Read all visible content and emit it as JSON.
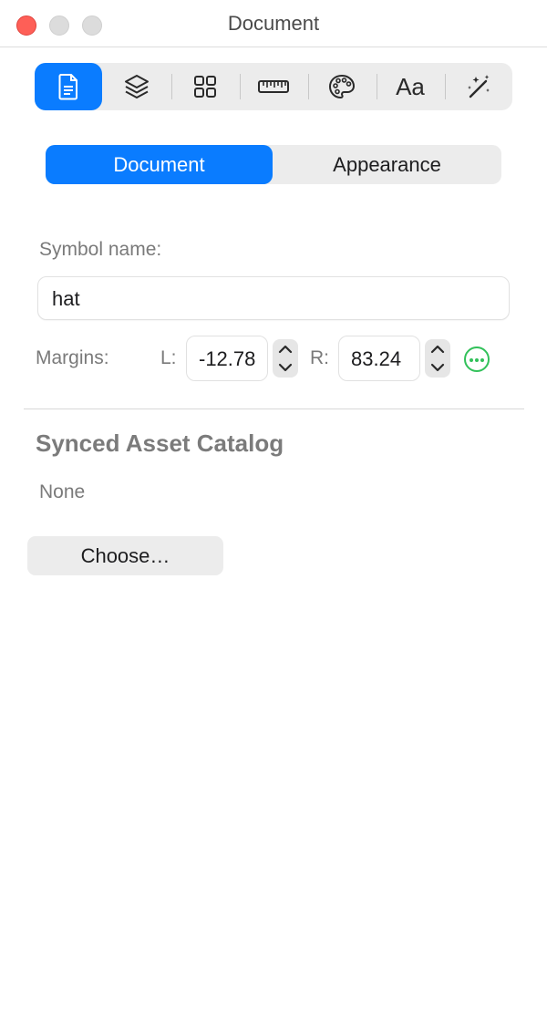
{
  "window": {
    "title": "Document"
  },
  "toolbar": {
    "items": [
      {
        "icon": "document-icon",
        "active": true
      },
      {
        "icon": "layers-icon",
        "active": false
      },
      {
        "icon": "grid-icon",
        "active": false
      },
      {
        "icon": "ruler-icon",
        "active": false
      },
      {
        "icon": "palette-icon",
        "active": false
      },
      {
        "icon": "font-icon",
        "label": "Aa",
        "active": false
      },
      {
        "icon": "magic-wand-icon",
        "active": false
      }
    ],
    "accent_color": "#0a7cff"
  },
  "segmented": {
    "document_label": "Document",
    "appearance_label": "Appearance",
    "selected": "Document"
  },
  "symbol": {
    "name_label": "Symbol name:",
    "name_value": "hat"
  },
  "margins": {
    "label": "Margins:",
    "left_label": "L:",
    "left_value": "-12.78",
    "right_label": "R:",
    "right_value": "83.24"
  },
  "synced_catalog": {
    "title": "Synced Asset Catalog",
    "value": "None",
    "choose_label": "Choose…"
  }
}
